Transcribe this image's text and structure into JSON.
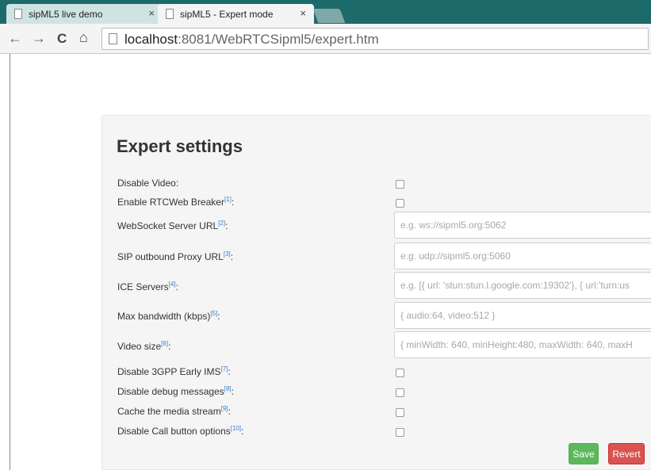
{
  "browser": {
    "tabs": [
      {
        "title": "sipML5 live demo",
        "close": "×"
      },
      {
        "title": "sipML5 - Expert mode",
        "close": "×"
      }
    ],
    "nav": {
      "back": "←",
      "forward": "→",
      "reload": "C",
      "home": "⌂"
    },
    "url_host": "localhost",
    "url_rest": ":8081/WebRTCSipml5/expert.htm"
  },
  "page": {
    "heading": "Expert settings",
    "fields": [
      {
        "label": "Disable Video",
        "ref": "",
        "type": "checkbox"
      },
      {
        "label": "Enable RTCWeb Breaker",
        "ref": "[1]",
        "type": "checkbox"
      },
      {
        "label": "WebSocket Server URL",
        "ref": "[2]",
        "type": "text",
        "placeholder": "e.g. ws://sipml5.org:5062"
      },
      {
        "label": "SIP outbound Proxy URL",
        "ref": "[3]",
        "type": "text",
        "placeholder": "e.g. udp://sipml5.org:5060"
      },
      {
        "label": "ICE Servers",
        "ref": "[4]",
        "type": "text",
        "placeholder": "e.g. [{ url: 'stun:stun.l.google.com:19302'}, { url:'turn:us"
      },
      {
        "label": "Max bandwidth (kbps)",
        "ref": "[5]",
        "type": "text",
        "placeholder": "{ audio:64, video:512 }"
      },
      {
        "label": "Video size",
        "ref": "[6]",
        "type": "text",
        "placeholder": "{ minWidth: 640, minHeight:480, maxWidth: 640, maxH"
      },
      {
        "label": "Disable 3GPP Early IMS",
        "ref": "[7]",
        "type": "checkbox"
      },
      {
        "label": "Disable debug messages",
        "ref": "[8]",
        "type": "checkbox"
      },
      {
        "label": "Cache the media stream",
        "ref": "[9]",
        "type": "checkbox"
      },
      {
        "label": "Disable Call button options",
        "ref": "[10]",
        "type": "checkbox"
      }
    ],
    "colon": ":",
    "buttons": {
      "save": "Save",
      "revert": "Revert"
    }
  }
}
